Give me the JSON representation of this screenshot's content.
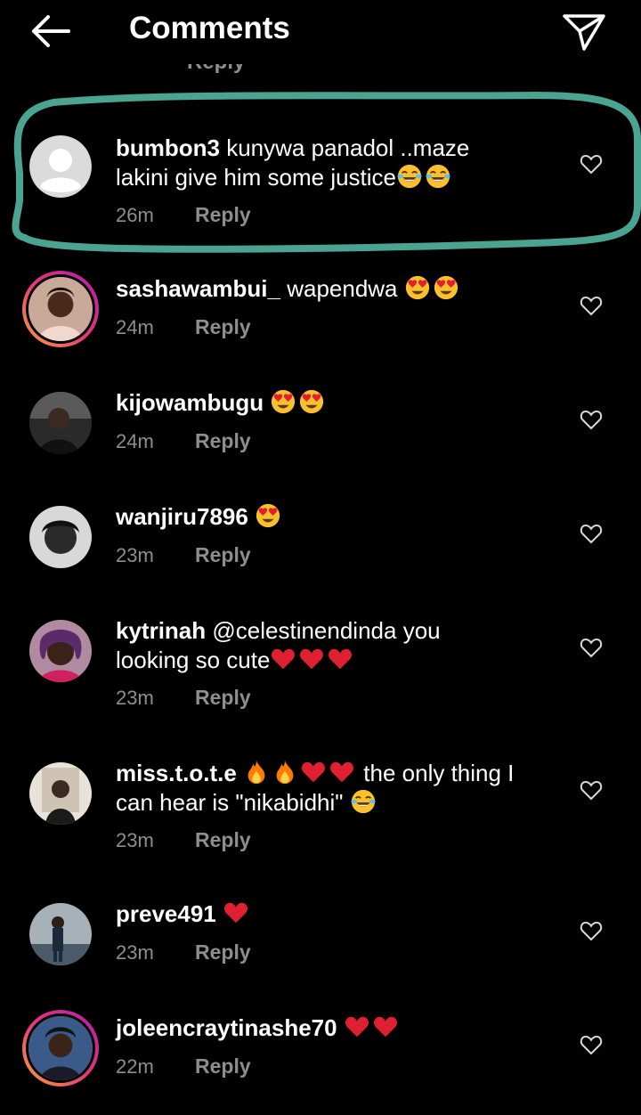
{
  "header": {
    "title": "Comments",
    "back_icon": "arrow-left-icon",
    "send_icon": "paper-plane-icon"
  },
  "peek_reply": "Reply",
  "colors": {
    "background": "#000000",
    "meta_gray": "#8e8e8e",
    "highlight_teal": "#4aa491",
    "heart_red": "#e02030",
    "emoji_yellow": "#fbc02d"
  },
  "comments": [
    {
      "username": "bumbon3",
      "line1": " kunywa panadol ..maze",
      "line2": "lakini give him some justice",
      "emojis": [
        "tears-of-joy-emoji",
        "tears-of-joy-emoji"
      ],
      "time": "26m",
      "reply": "Reply",
      "avatar": "default-avatar",
      "highlighted": true
    },
    {
      "username": "sashawambui_",
      "line1": " wapendwa ",
      "emojis": [
        "heart-eyes-emoji",
        "heart-eyes-emoji"
      ],
      "time": "24m",
      "reply": "Reply",
      "avatar": "story-ring-avatar"
    },
    {
      "username": "kijowambugu",
      "line1": " ",
      "emojis": [
        "heart-eyes-emoji",
        "heart-eyes-emoji"
      ],
      "time": "24m",
      "reply": "Reply",
      "avatar": "photo-avatar"
    },
    {
      "username": "wanjiru7896",
      "line1": " ",
      "emojis": [
        "heart-eyes-emoji"
      ],
      "time": "23m",
      "reply": "Reply",
      "avatar": "photo-avatar"
    },
    {
      "username": "kytrinah",
      "line1": " @celestinendinda you",
      "line2": "looking so cute",
      "emojis": [
        "red-heart-emoji",
        "red-heart-emoji",
        "red-heart-emoji"
      ],
      "time": "23m",
      "reply": "Reply",
      "avatar": "photo-avatar"
    },
    {
      "username": "miss.t.o.t.e",
      "line1_after": " the only thing I",
      "line2": "can hear is \"nikabidhi\" ",
      "emojis_line1": [
        "fire-emoji",
        "fire-emoji",
        "red-heart-emoji",
        "red-heart-emoji"
      ],
      "emojis_line2": [
        "tears-of-joy-emoji"
      ],
      "time": "23m",
      "reply": "Reply",
      "avatar": "photo-avatar"
    },
    {
      "username": "preve491",
      "line1": " ",
      "emojis": [
        "red-heart-emoji"
      ],
      "time": "23m",
      "reply": "Reply",
      "avatar": "photo-avatar"
    },
    {
      "username": "joleencraytinashe70",
      "line1": " ",
      "emojis": [
        "red-heart-emoji",
        "red-heart-emoji"
      ],
      "time": "22m",
      "reply": "Reply",
      "avatar": "story-ring-avatar"
    }
  ]
}
